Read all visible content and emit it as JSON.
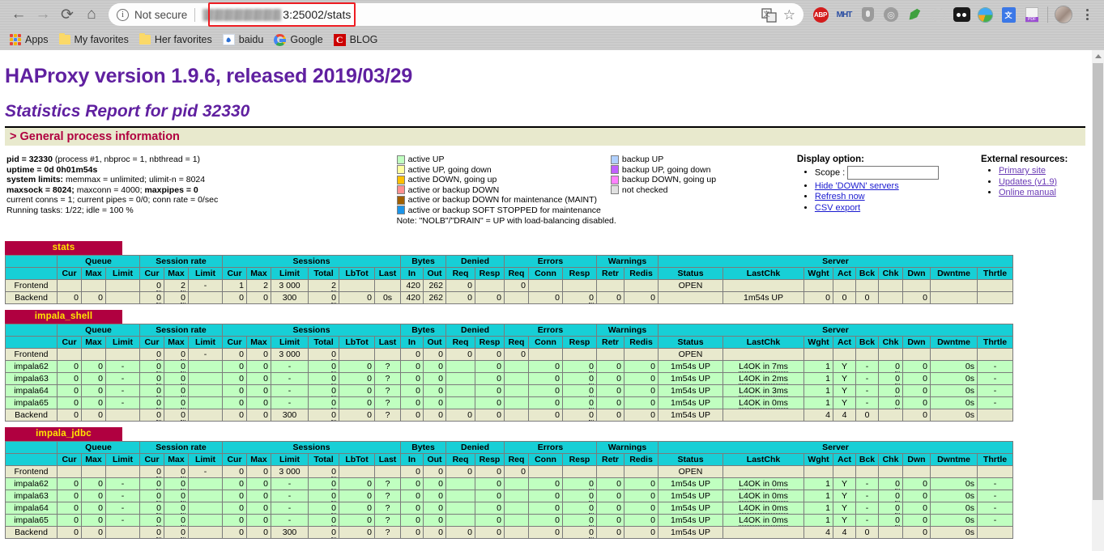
{
  "browser": {
    "back_icon": "back-arrow-icon",
    "forward_icon": "forward-arrow-icon",
    "reload_icon": "reload-icon",
    "home_icon": "home-icon",
    "security_label": "Not secure",
    "url_visible_tail": "3:25002/stats",
    "url_port_path": ":25002/stats",
    "translate_icon": "translate-icon",
    "bookmark_star_icon": "star-icon",
    "menu_icon": "kebab-menu-icon",
    "extensions": [
      "adblock-plus-icon",
      "mht-icon",
      "shield-icon",
      "ring-icon",
      "leaf-icon",
      "compass-icon",
      "oo-icon",
      "globe-icon",
      "google-translate-icon",
      "pdf-icon",
      "avatar-icon"
    ],
    "bookmarks": [
      {
        "label": "Apps",
        "icon": "apps-grid-icon"
      },
      {
        "label": "My favorites",
        "icon": "folder-icon"
      },
      {
        "label": "Her favorites",
        "icon": "folder-icon"
      },
      {
        "label": "baidu",
        "icon": "baidu-icon"
      },
      {
        "label": "Google",
        "icon": "google-icon"
      },
      {
        "label": "BLOG",
        "icon": "c-icon"
      }
    ]
  },
  "page": {
    "title": "HAProxy version 1.9.6, released 2019/03/29",
    "subtitle": "Statistics Report for pid 32330",
    "section_header": "> General process information"
  },
  "process_info": {
    "line1_label": "pid = 32330",
    "line1_rest": " (process #1, nbproc = 1, nbthread = 1)",
    "line2_label": "uptime = 0d 0h01m54s",
    "line3_label": "system limits:",
    "line3_rest": " memmax = unlimited; ulimit-n = 8024",
    "line4_label": "maxsock = 8024;",
    "line4_mid": " maxconn = 4000;",
    "line4_label2": " maxpipes = 0",
    "line5": "current conns = 1; current pipes = 0/0; conn rate = 0/sec",
    "line6": "Running tasks: 1/22; idle = 100 %"
  },
  "legend": {
    "left": [
      {
        "label": "active UP",
        "color": "#c0ffc0"
      },
      {
        "label": "active UP, going down",
        "color": "#ffffa0"
      },
      {
        "label": "active DOWN, going up",
        "color": "#ffc000"
      },
      {
        "label": "active or backup DOWN",
        "color": "#ff9090"
      },
      {
        "label": "active or backup DOWN for maintenance (MAINT)",
        "color": "#a06000"
      },
      {
        "label": "active or backup SOFT STOPPED for maintenance",
        "color": "#1c94e8"
      }
    ],
    "right": [
      {
        "label": "backup UP",
        "color": "#b0d0ff"
      },
      {
        "label": "backup UP, going down",
        "color": "#c060ff"
      },
      {
        "label": "backup DOWN, going up",
        "color": "#ff80ff"
      },
      {
        "label": "not checked",
        "color": "#e0e0e0"
      }
    ],
    "note": "Note: \"NOLB\"/\"DRAIN\" = UP with load-balancing disabled."
  },
  "display_option": {
    "title": "Display option:",
    "scope_label": "Scope :",
    "scope_value": "",
    "links": [
      "Hide 'DOWN' servers",
      "Refresh now",
      "CSV export"
    ]
  },
  "external_resources": {
    "title": "External resources:",
    "links": [
      "Primary site",
      "Updates (v1.9)",
      "Online manual"
    ]
  },
  "table_headers": {
    "groups": [
      "Queue",
      "Session rate",
      "Sessions",
      "Bytes",
      "Denied",
      "Errors",
      "Warnings",
      "Server"
    ],
    "queue": [
      "Cur",
      "Max",
      "Limit"
    ],
    "session_rate": [
      "Cur",
      "Max",
      "Limit"
    ],
    "sessions": [
      "Cur",
      "Max",
      "Limit",
      "Total",
      "LbTot",
      "Last"
    ],
    "bytes": [
      "In",
      "Out"
    ],
    "denied": [
      "Req",
      "Resp"
    ],
    "errors": [
      "Req",
      "Conn",
      "Resp"
    ],
    "warnings": [
      "Retr",
      "Redis"
    ],
    "server": [
      "Status",
      "LastChk",
      "Wght",
      "Act",
      "Bck",
      "Chk",
      "Dwn",
      "Dwntme",
      "Thrtle"
    ]
  },
  "proxies": [
    {
      "name": "stats",
      "rows": [
        {
          "type": "frontend",
          "name": "Frontend",
          "q_cur": "",
          "q_max": "",
          "q_limit": "",
          "sr_cur": "0",
          "sr_max": "2",
          "sr_limit": "-",
          "s_cur": "1",
          "s_max": "2",
          "s_limit": "3 000",
          "s_total": "2",
          "s_lbtot": "",
          "s_last": "",
          "b_in": "420",
          "b_out": "262",
          "d_req": "0",
          "d_resp": "",
          "e_req": "0",
          "e_conn": "",
          "e_resp": "",
          "w_retr": "",
          "w_redis": "",
          "status": "OPEN",
          "lastchk": "",
          "wght": "",
          "act": "",
          "bck": "",
          "chk": "",
          "dwn": "",
          "dwntme": "",
          "thrtle": ""
        },
        {
          "type": "backend",
          "name": "Backend",
          "q_cur": "0",
          "q_max": "0",
          "q_limit": "",
          "sr_cur": "0",
          "sr_max": "0",
          "sr_limit": "",
          "s_cur": "0",
          "s_max": "0",
          "s_limit": "300",
          "s_total": "0",
          "s_lbtot": "0",
          "s_last": "0s",
          "b_in": "420",
          "b_out": "262",
          "d_req": "0",
          "d_resp": "0",
          "e_req": "",
          "e_conn": "0",
          "e_resp": "0",
          "w_retr": "0",
          "w_redis": "0",
          "status": "",
          "lastchk": "1m54s UP",
          "wght": "0",
          "act": "0",
          "bck": "0",
          "chk": "",
          "dwn": "0",
          "dwntme": "",
          "thrtle": ""
        }
      ]
    },
    {
      "name": "impala_shell",
      "rows": [
        {
          "type": "frontend",
          "name": "Frontend",
          "q_cur": "",
          "q_max": "",
          "q_limit": "",
          "sr_cur": "0",
          "sr_max": "0",
          "sr_limit": "-",
          "s_cur": "0",
          "s_max": "0",
          "s_limit": "3 000",
          "s_total": "0",
          "s_lbtot": "",
          "s_last": "",
          "b_in": "0",
          "b_out": "0",
          "d_req": "0",
          "d_resp": "0",
          "e_req": "0",
          "e_conn": "",
          "e_resp": "",
          "w_retr": "",
          "w_redis": "",
          "status": "OPEN",
          "lastchk": "",
          "wght": "",
          "act": "",
          "bck": "",
          "chk": "",
          "dwn": "",
          "dwntme": "",
          "thrtle": ""
        },
        {
          "type": "server",
          "name": "impala62",
          "q_cur": "0",
          "q_max": "0",
          "q_limit": "-",
          "sr_cur": "0",
          "sr_max": "0",
          "sr_limit": "",
          "s_cur": "0",
          "s_max": "0",
          "s_limit": "-",
          "s_total": "0",
          "s_lbtot": "0",
          "s_last": "?",
          "b_in": "0",
          "b_out": "0",
          "d_req": "",
          "d_resp": "0",
          "e_req": "",
          "e_conn": "0",
          "e_resp": "0",
          "w_retr": "0",
          "w_redis": "0",
          "status": "1m54s UP",
          "lastchk": "L4OK in 7ms",
          "wght": "1",
          "act": "Y",
          "bck": "-",
          "chk": "0",
          "dwn": "0",
          "dwntme": "0s",
          "thrtle": "-"
        },
        {
          "type": "server",
          "name": "impala63",
          "q_cur": "0",
          "q_max": "0",
          "q_limit": "-",
          "sr_cur": "0",
          "sr_max": "0",
          "sr_limit": "",
          "s_cur": "0",
          "s_max": "0",
          "s_limit": "-",
          "s_total": "0",
          "s_lbtot": "0",
          "s_last": "?",
          "b_in": "0",
          "b_out": "0",
          "d_req": "",
          "d_resp": "0",
          "e_req": "",
          "e_conn": "0",
          "e_resp": "0",
          "w_retr": "0",
          "w_redis": "0",
          "status": "1m54s UP",
          "lastchk": "L4OK in 2ms",
          "wght": "1",
          "act": "Y",
          "bck": "-",
          "chk": "0",
          "dwn": "0",
          "dwntme": "0s",
          "thrtle": "-"
        },
        {
          "type": "server",
          "name": "impala64",
          "q_cur": "0",
          "q_max": "0",
          "q_limit": "-",
          "sr_cur": "0",
          "sr_max": "0",
          "sr_limit": "",
          "s_cur": "0",
          "s_max": "0",
          "s_limit": "-",
          "s_total": "0",
          "s_lbtot": "0",
          "s_last": "?",
          "b_in": "0",
          "b_out": "0",
          "d_req": "",
          "d_resp": "0",
          "e_req": "",
          "e_conn": "0",
          "e_resp": "0",
          "w_retr": "0",
          "w_redis": "0",
          "status": "1m54s UP",
          "lastchk": "L4OK in 3ms",
          "wght": "1",
          "act": "Y",
          "bck": "-",
          "chk": "0",
          "dwn": "0",
          "dwntme": "0s",
          "thrtle": "-"
        },
        {
          "type": "server",
          "name": "impala65",
          "q_cur": "0",
          "q_max": "0",
          "q_limit": "-",
          "sr_cur": "0",
          "sr_max": "0",
          "sr_limit": "",
          "s_cur": "0",
          "s_max": "0",
          "s_limit": "-",
          "s_total": "0",
          "s_lbtot": "0",
          "s_last": "?",
          "b_in": "0",
          "b_out": "0",
          "d_req": "",
          "d_resp": "0",
          "e_req": "",
          "e_conn": "0",
          "e_resp": "0",
          "w_retr": "0",
          "w_redis": "0",
          "status": "1m54s UP",
          "lastchk": "L4OK in 0ms",
          "wght": "1",
          "act": "Y",
          "bck": "-",
          "chk": "0",
          "dwn": "0",
          "dwntme": "0s",
          "thrtle": "-"
        },
        {
          "type": "backend",
          "name": "Backend",
          "q_cur": "0",
          "q_max": "0",
          "q_limit": "",
          "sr_cur": "0",
          "sr_max": "0",
          "sr_limit": "",
          "s_cur": "0",
          "s_max": "0",
          "s_limit": "300",
          "s_total": "0",
          "s_lbtot": "0",
          "s_last": "?",
          "b_in": "0",
          "b_out": "0",
          "d_req": "0",
          "d_resp": "0",
          "e_req": "",
          "e_conn": "0",
          "e_resp": "0",
          "w_retr": "0",
          "w_redis": "0",
          "status": "1m54s UP",
          "lastchk": "",
          "wght": "4",
          "act": "4",
          "bck": "0",
          "chk": "",
          "dwn": "0",
          "dwntme": "0s",
          "thrtle": ""
        }
      ]
    },
    {
      "name": "impala_jdbc",
      "rows": [
        {
          "type": "frontend",
          "name": "Frontend",
          "q_cur": "",
          "q_max": "",
          "q_limit": "",
          "sr_cur": "0",
          "sr_max": "0",
          "sr_limit": "-",
          "s_cur": "0",
          "s_max": "0",
          "s_limit": "3 000",
          "s_total": "0",
          "s_lbtot": "",
          "s_last": "",
          "b_in": "0",
          "b_out": "0",
          "d_req": "0",
          "d_resp": "0",
          "e_req": "0",
          "e_conn": "",
          "e_resp": "",
          "w_retr": "",
          "w_redis": "",
          "status": "OPEN",
          "lastchk": "",
          "wght": "",
          "act": "",
          "bck": "",
          "chk": "",
          "dwn": "",
          "dwntme": "",
          "thrtle": ""
        },
        {
          "type": "server",
          "name": "impala62",
          "q_cur": "0",
          "q_max": "0",
          "q_limit": "-",
          "sr_cur": "0",
          "sr_max": "0",
          "sr_limit": "",
          "s_cur": "0",
          "s_max": "0",
          "s_limit": "-",
          "s_total": "0",
          "s_lbtot": "0",
          "s_last": "?",
          "b_in": "0",
          "b_out": "0",
          "d_req": "",
          "d_resp": "0",
          "e_req": "",
          "e_conn": "0",
          "e_resp": "0",
          "w_retr": "0",
          "w_redis": "0",
          "status": "1m54s UP",
          "lastchk": "L4OK in 0ms",
          "wght": "1",
          "act": "Y",
          "bck": "-",
          "chk": "0",
          "dwn": "0",
          "dwntme": "0s",
          "thrtle": "-"
        },
        {
          "type": "server",
          "name": "impala63",
          "q_cur": "0",
          "q_max": "0",
          "q_limit": "-",
          "sr_cur": "0",
          "sr_max": "0",
          "sr_limit": "",
          "s_cur": "0",
          "s_max": "0",
          "s_limit": "-",
          "s_total": "0",
          "s_lbtot": "0",
          "s_last": "?",
          "b_in": "0",
          "b_out": "0",
          "d_req": "",
          "d_resp": "0",
          "e_req": "",
          "e_conn": "0",
          "e_resp": "0",
          "w_retr": "0",
          "w_redis": "0",
          "status": "1m54s UP",
          "lastchk": "L4OK in 0ms",
          "wght": "1",
          "act": "Y",
          "bck": "-",
          "chk": "0",
          "dwn": "0",
          "dwntme": "0s",
          "thrtle": "-"
        },
        {
          "type": "server",
          "name": "impala64",
          "q_cur": "0",
          "q_max": "0",
          "q_limit": "-",
          "sr_cur": "0",
          "sr_max": "0",
          "sr_limit": "",
          "s_cur": "0",
          "s_max": "0",
          "s_limit": "-",
          "s_total": "0",
          "s_lbtot": "0",
          "s_last": "?",
          "b_in": "0",
          "b_out": "0",
          "d_req": "",
          "d_resp": "0",
          "e_req": "",
          "e_conn": "0",
          "e_resp": "0",
          "w_retr": "0",
          "w_redis": "0",
          "status": "1m54s UP",
          "lastchk": "L4OK in 0ms",
          "wght": "1",
          "act": "Y",
          "bck": "-",
          "chk": "0",
          "dwn": "0",
          "dwntme": "0s",
          "thrtle": "-"
        },
        {
          "type": "server",
          "name": "impala65",
          "q_cur": "0",
          "q_max": "0",
          "q_limit": "-",
          "sr_cur": "0",
          "sr_max": "0",
          "sr_limit": "",
          "s_cur": "0",
          "s_max": "0",
          "s_limit": "-",
          "s_total": "0",
          "s_lbtot": "0",
          "s_last": "?",
          "b_in": "0",
          "b_out": "0",
          "d_req": "",
          "d_resp": "0",
          "e_req": "",
          "e_conn": "0",
          "e_resp": "0",
          "w_retr": "0",
          "w_redis": "0",
          "status": "1m54s UP",
          "lastchk": "L4OK in 0ms",
          "wght": "1",
          "act": "Y",
          "bck": "-",
          "chk": "0",
          "dwn": "0",
          "dwntme": "0s",
          "thrtle": "-"
        },
        {
          "type": "backend",
          "name": "Backend",
          "q_cur": "0",
          "q_max": "0",
          "q_limit": "",
          "sr_cur": "0",
          "sr_max": "0",
          "sr_limit": "",
          "s_cur": "0",
          "s_max": "0",
          "s_limit": "300",
          "s_total": "0",
          "s_lbtot": "0",
          "s_last": "?",
          "b_in": "0",
          "b_out": "0",
          "d_req": "0",
          "d_resp": "0",
          "e_req": "",
          "e_conn": "0",
          "e_resp": "0",
          "w_retr": "0",
          "w_redis": "0",
          "status": "1m54s UP",
          "lastchk": "",
          "wght": "4",
          "act": "4",
          "bck": "0",
          "chk": "",
          "dwn": "0",
          "dwntme": "0s",
          "thrtle": ""
        }
      ]
    }
  ]
}
